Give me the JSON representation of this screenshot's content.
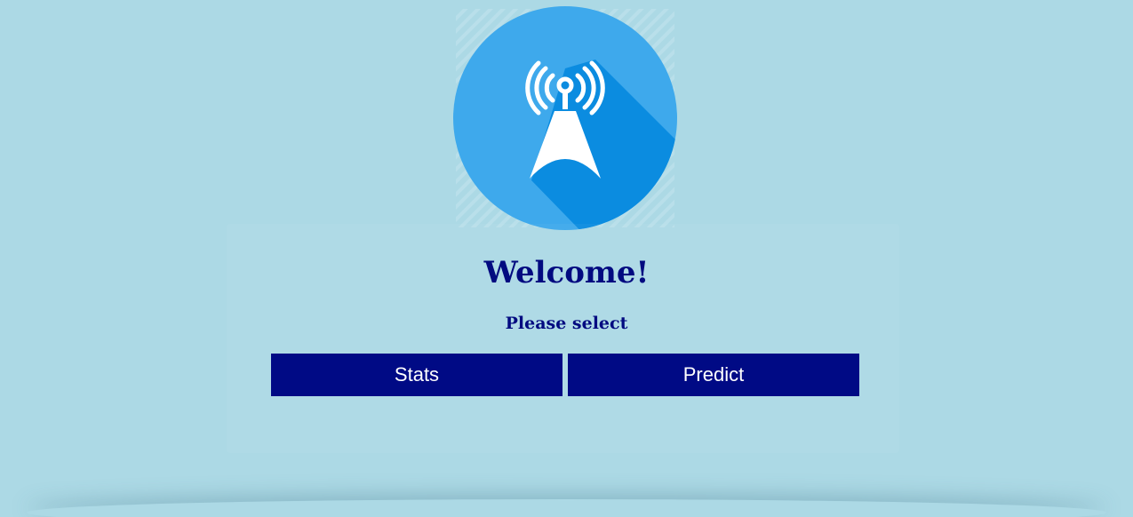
{
  "logo": {
    "icon": "radio-tower-icon",
    "colors": {
      "circle": "#3ea9ec",
      "shadow": "#0b8ce0",
      "tower": "#ffffff"
    }
  },
  "heading": "Welcome!",
  "subheading": "Please select",
  "buttons": {
    "stats_label": "Stats",
    "predict_label": "Predict"
  },
  "colors": {
    "background": "#acd9e5",
    "accent": "#000a85",
    "text": "#020a80"
  }
}
